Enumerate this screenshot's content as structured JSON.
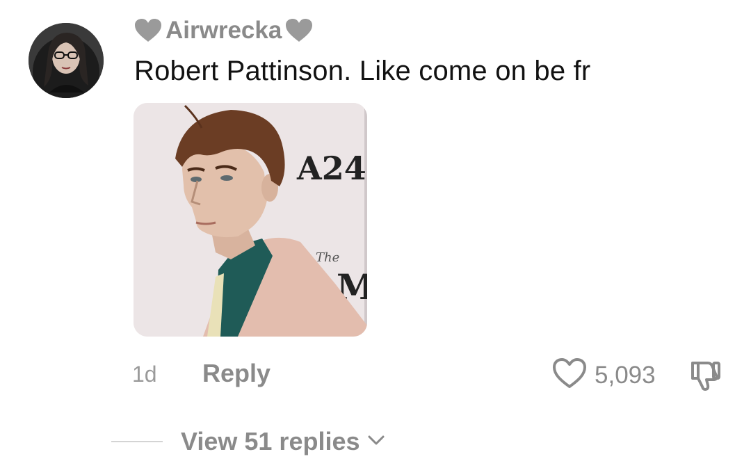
{
  "comment": {
    "username": "Airwrecka",
    "username_decoration_icon": "grey-heart-icon",
    "text": "Robert Pattinson. Like come on be fr",
    "image_backdrop_text": "A24",
    "image_backdrop_text_2": "The",
    "image_backdrop_text_3": "M",
    "timestamp": "1d",
    "reply_label": "Reply",
    "like_count": "5,093",
    "like_icon": "heart-outline-icon",
    "dislike_icon": "thumbs-down-icon"
  },
  "replies": {
    "label": "View 51 replies",
    "expand_icon": "chevron-down-icon"
  },
  "colors": {
    "muted_text": "#8a8a8a",
    "primary_text": "#121212",
    "heart_grey": "#9a9a9a"
  }
}
